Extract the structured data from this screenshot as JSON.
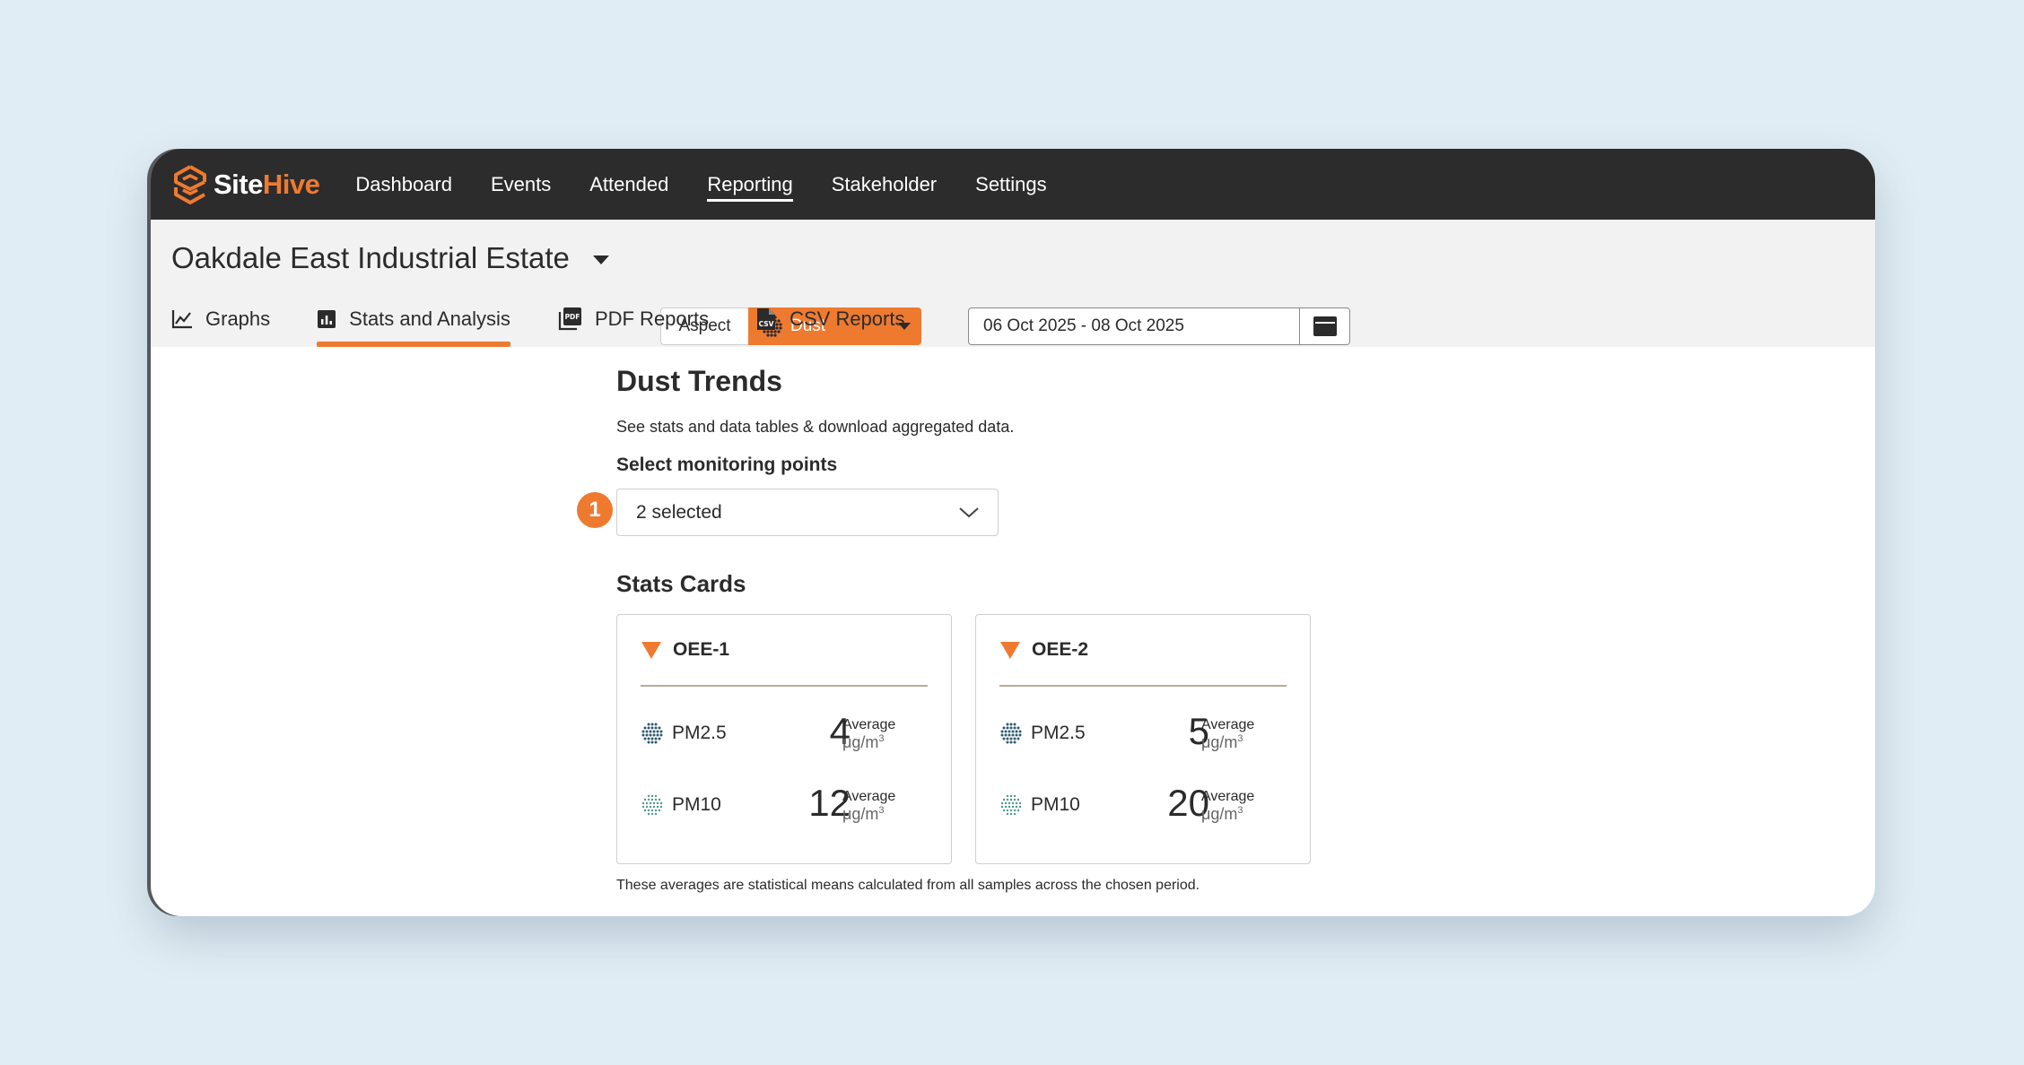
{
  "brand": {
    "site": "Site",
    "hive": "Hive",
    "accent": "#ee7a30",
    "nav_bg": "#2c2c2c"
  },
  "nav": {
    "items": [
      {
        "label": "Dashboard"
      },
      {
        "label": "Events"
      },
      {
        "label": "Attended"
      },
      {
        "label": "Reporting",
        "active": true
      },
      {
        "label": "Stakeholder"
      },
      {
        "label": "Settings"
      }
    ]
  },
  "header": {
    "site_name": "Oakdale East Industrial Estate",
    "aspect_label": "Aspect",
    "aspect_value": "Dust",
    "date_range": "06 Oct 2025 - 08 Oct 2025"
  },
  "tabs": [
    {
      "label": "Graphs",
      "icon": "line-chart-icon"
    },
    {
      "label": "Stats and Analysis",
      "icon": "bar-chart-icon",
      "active": true
    },
    {
      "label": "PDF Reports",
      "icon": "pdf-file-icon"
    },
    {
      "label": "CSV Reports",
      "icon": "csv-file-icon"
    }
  ],
  "main": {
    "title": "Dust Trends",
    "description": "See stats and data tables & download aggregated data.",
    "points_label": "Select monitoring points",
    "step_number": "1",
    "points_value": "2 selected",
    "stats_title": "Stats Cards",
    "cards": [
      {
        "name": "OEE-1",
        "metrics": [
          {
            "name": "PM2.5",
            "value": "4",
            "avg": "Average",
            "unit": "μg/m",
            "unit_sup": "3"
          },
          {
            "name": "PM10",
            "value": "12",
            "avg": "Average",
            "unit": "μg/m",
            "unit_sup": "3"
          }
        ]
      },
      {
        "name": "OEE-2",
        "metrics": [
          {
            "name": "PM2.5",
            "value": "5",
            "avg": "Average",
            "unit": "μg/m",
            "unit_sup": "3"
          },
          {
            "name": "PM10",
            "value": "20",
            "avg": "Average",
            "unit": "μg/m",
            "unit_sup": "3"
          }
        ]
      }
    ],
    "footnote": "These averages are statistical means calculated from all samples across the chosen period."
  }
}
